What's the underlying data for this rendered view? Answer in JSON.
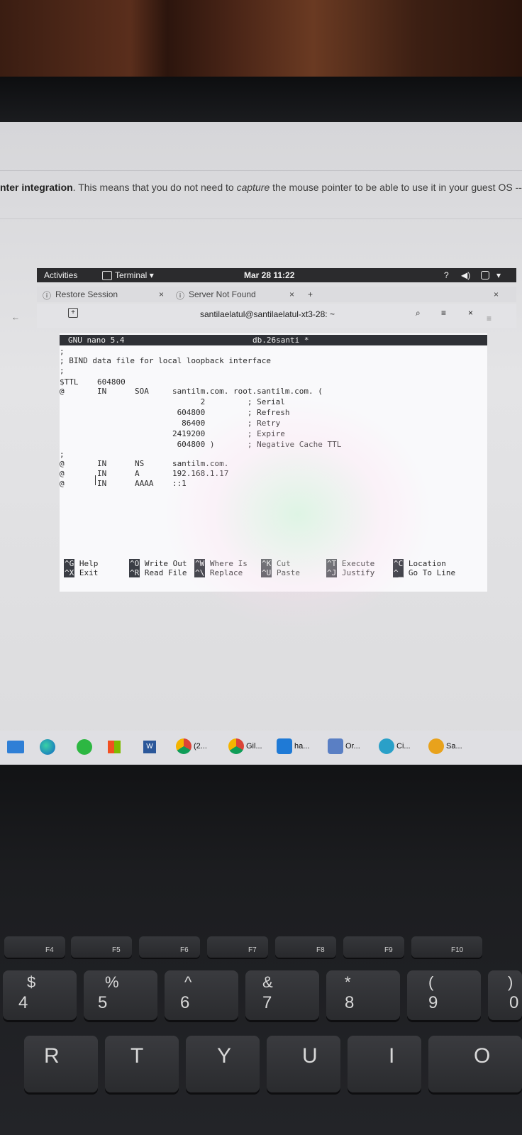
{
  "doc": {
    "bold": "nter integration",
    "text1": ". This means that you do not need to ",
    "italic": "capture",
    "text2": " the mouse pointer to be able to use it in your guest OS --"
  },
  "gnome": {
    "activities": "Activities",
    "app": "Terminal",
    "clock": "Mar 28 11:22"
  },
  "vm_tabs": [
    {
      "label": "Restore Session"
    },
    {
      "label": "Server Not Found"
    }
  ],
  "terminal": {
    "title": "santilaelatul@santilaelatul-xt3-28: ~"
  },
  "nano": {
    "version": "GNU nano 5.4",
    "filename": "db.26santi *",
    "lines": [
      ";",
      "; BIND data file for local loopback interface",
      ";",
      "$TTL    604800",
      "@       IN      SOA     santilm.com. root.santilm.com. (",
      "                              2         ; Serial",
      "                         604800         ; Refresh",
      "                          86400         ; Retry",
      "                        2419200         ; Expire",
      "                         604800 )       ; Negative Cache TTL",
      ";",
      "@       IN      NS      santilm.com.",
      "@       IN      A       192.168.1.17",
      "@       IN      AAAA    ::1"
    ],
    "shortcuts": [
      {
        "key1": "^G",
        "label1": "Help",
        "key2": "^X",
        "label2": "Exit"
      },
      {
        "key1": "^O",
        "label1": "Write Out",
        "key2": "^R",
        "label2": "Read File"
      },
      {
        "key1": "^W",
        "label1": "Where Is",
        "key2": "^\\",
        "label2": "Replace"
      },
      {
        "key1": "^K",
        "label1": "Cut",
        "key2": "^U",
        "label2": "Paste"
      },
      {
        "key1": "^T",
        "label1": "Execute",
        "key2": "^J",
        "label2": "Justify"
      },
      {
        "key1": "^C",
        "label1": "Location",
        "key2": "^_",
        "label2": "Go To Line"
      }
    ]
  },
  "taskbar": [
    {
      "label": "(2...",
      "icon": "chrome-icon"
    },
    {
      "label": "Gil...",
      "icon": "chrome-profile-icon"
    },
    {
      "label": "ha...",
      "icon": "vscode-icon"
    },
    {
      "label": "Or...",
      "icon": "virtualbox-icon"
    },
    {
      "label": "Ci...",
      "icon": "cisco-icon"
    },
    {
      "label": "Sa...",
      "icon": "app-icon"
    }
  ],
  "keyboard": {
    "fkeys": [
      "F4",
      "F5",
      "F6",
      "F7",
      "F8",
      "F9",
      "F10"
    ],
    "num_top": [
      "$",
      "%",
      "^",
      "&",
      "*",
      "(",
      ")"
    ],
    "num_bottom": [
      "4",
      "5",
      "6",
      "7",
      "8",
      "9",
      "0"
    ],
    "letters": [
      "R",
      "T",
      "Y",
      "U",
      "I",
      "O"
    ]
  },
  "colors": {
    "nano_bar": "#2f3136",
    "topbar": "#2b2b2d"
  }
}
